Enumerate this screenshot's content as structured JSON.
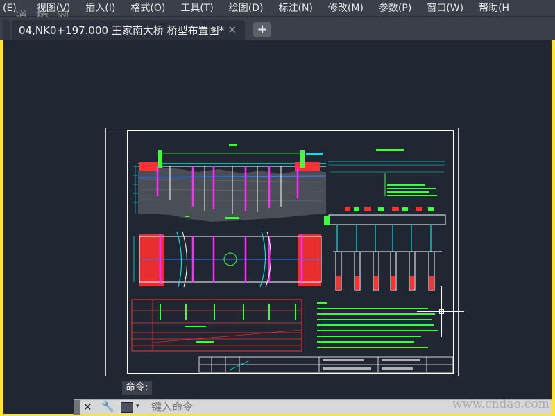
{
  "menu": {
    "items": [
      "(E)",
      "视图(V)",
      "插入(I)",
      "格式(O)",
      "工具(T)",
      "绘图(D)",
      "标注(N)",
      "修改(M)",
      "参数(P)",
      "窗口(W)",
      "帮助(H"
    ]
  },
  "watermark_top": "道 桥 网",
  "tab": {
    "title": "04,NK0+197.000 王家南大桥  桥型布置图*",
    "close": "✕",
    "new_tab": "+"
  },
  "command": {
    "label": "命令:",
    "placeholder": "键入命令",
    "close_icon": "close-icon",
    "tools_icon": "wrench-icon"
  },
  "watermark_bottom": "www.cndao.com",
  "colors": {
    "canvas_bg": "#212732",
    "frame": "#fce43a",
    "line_cyan": "#00e5e5",
    "line_green": "#3cff3c",
    "line_red": "#ff3030",
    "line_magenta": "#ff2bff",
    "line_white": "#ffffff"
  }
}
